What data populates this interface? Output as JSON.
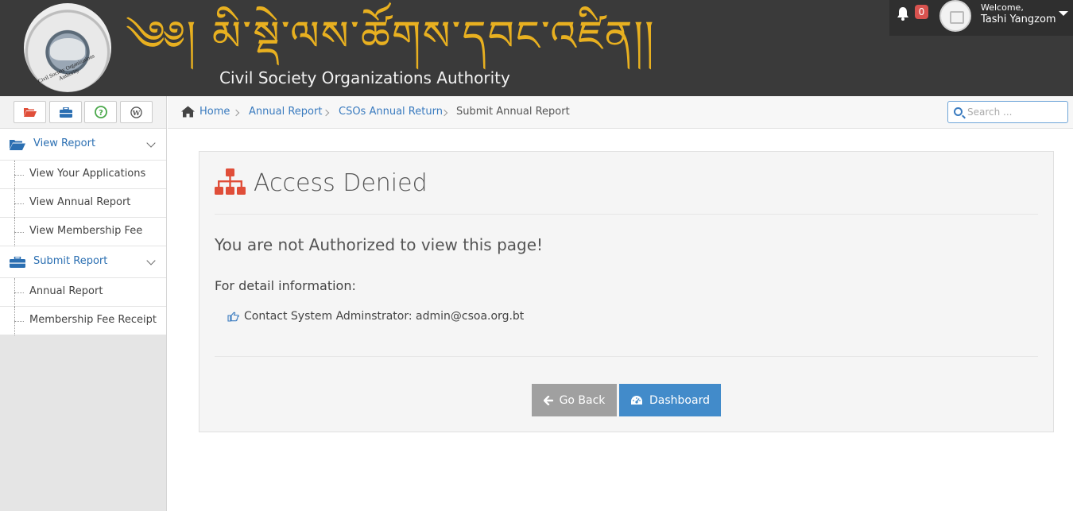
{
  "header": {
    "tibetan_title": "༄༅། མི་སྡེ་ལས་ཚོགས་དབང་འཛིན།།",
    "org_name": "Civil Society Organizations Authority",
    "emblem_text": "Civil Society Organizations Authority",
    "notifications_count": "0",
    "welcome_label": "Welcome,",
    "user_name": "Tashi Yangzom"
  },
  "sidebar": {
    "shortcut_icons": [
      "folder-open-icon",
      "briefcase-icon",
      "help-circle-icon",
      "wordpress-icon"
    ],
    "groups": [
      {
        "label": "View Report",
        "icon": "folder-open-icon",
        "items": [
          {
            "label": "View Your Applications"
          },
          {
            "label": "View Annual Report"
          },
          {
            "label": "View Membership Fee"
          }
        ]
      },
      {
        "label": "Submit Report",
        "icon": "briefcase-icon",
        "items": [
          {
            "label": "Annual Report"
          },
          {
            "label": "Membership Fee Receipt"
          }
        ]
      }
    ]
  },
  "breadcrumb": {
    "items": [
      "Home",
      "Annual Report",
      "CSOs Annual Return",
      "Submit Annual Report"
    ]
  },
  "search": {
    "placeholder": "Search ..."
  },
  "panel": {
    "title": "Access Denied",
    "message": "You are not Authorized to view this page!",
    "detail_heading": "For detail information:",
    "contact_text": "Contact System Adminstrator: admin@csoa.org.bt"
  },
  "buttons": {
    "back_label": "Go Back",
    "dashboard_label": "Dashboard"
  },
  "colors": {
    "header_bg": "#3a3a3a",
    "link_blue": "#3a7bbf",
    "title_gold": "#e8b020",
    "badge_red": "#d9534f",
    "icon_red": "#e04e39",
    "primary_button": "#428bca",
    "secondary_button": "#a0a0a0"
  }
}
